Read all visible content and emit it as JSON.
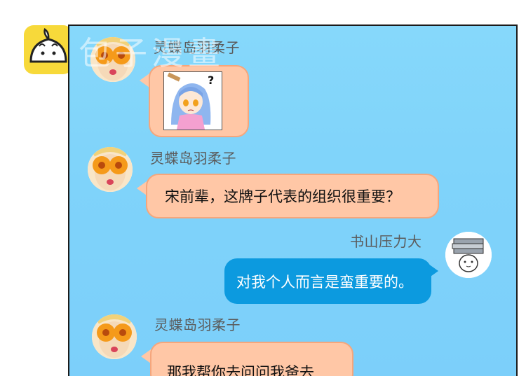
{
  "chat": {
    "messages": [
      {
        "sender": "灵蝶岛羽柔子",
        "side": "left",
        "type": "sticker",
        "sticker_icon": "confused-anime-girl-sticker",
        "sticker_mark": "?"
      },
      {
        "sender": "灵蝶岛羽柔子",
        "side": "left",
        "type": "text",
        "text": "宋前辈，这牌子代表的组织很重要？"
      },
      {
        "sender": "书山压力大",
        "side": "right",
        "type": "text",
        "text": "对我个人而言是蛮重要的。"
      },
      {
        "sender": "灵蝶岛羽柔子",
        "side": "left",
        "type": "text",
        "text": "那我帮你去问问我爸去"
      }
    ]
  },
  "watermark": {
    "text": "包子漫畫",
    "logo_icon": "bun-logo-icon"
  },
  "colors": {
    "background": "#80d4fa",
    "left_bubble": "#ffc7a6",
    "right_bubble": "#0c9adf",
    "name": "#5b5b5b"
  }
}
